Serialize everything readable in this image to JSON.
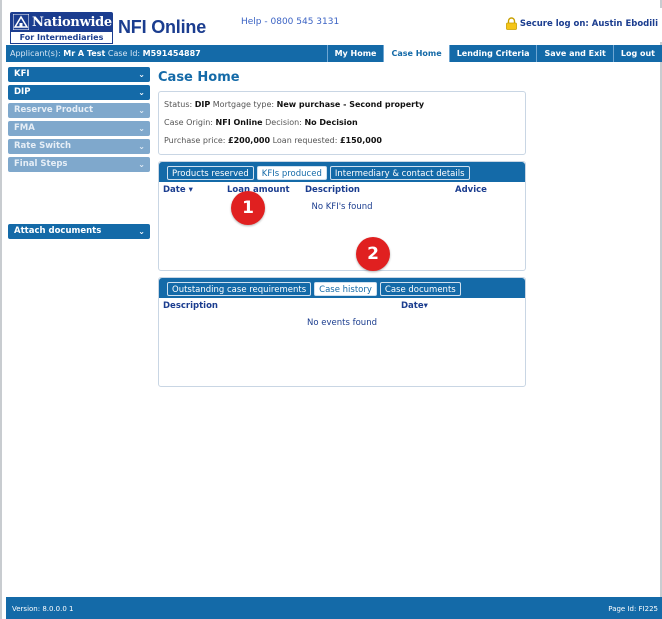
{
  "header": {
    "logo_name": "Nationwide",
    "logo_sub": "For Intermediaries",
    "app_title": "NFI Online",
    "help": "Help - 0800 545 3131",
    "secure": "Secure log on: Austin Ebodili",
    "brand_color": "#1b3d8f",
    "accent_color": "#146aa8"
  },
  "navbar": {
    "applicant_label": "Applicant(s):",
    "applicant_value": "Mr A Test",
    "case_id_label": "Case Id:",
    "case_id_value": "M591454887",
    "items": [
      "My Home",
      "Case Home",
      "Lending Criteria",
      "Save and Exit",
      "Log out"
    ],
    "active": "Case Home"
  },
  "sidebar": {
    "items": [
      {
        "label": "KFI",
        "enabled": true
      },
      {
        "label": "DIP",
        "enabled": true
      },
      {
        "label": "Reserve Product",
        "enabled": false
      },
      {
        "label": "FMA",
        "enabled": false
      },
      {
        "label": "Rate Switch",
        "enabled": false
      },
      {
        "label": "Final Steps",
        "enabled": false
      }
    ],
    "attach": "Attach documents"
  },
  "main": {
    "title": "Case Home",
    "summary": {
      "status_label": "Status:",
      "status_value": "DIP",
      "mortgage_type_label": "Mortgage type:",
      "mortgage_type_value": "New purchase - Second property",
      "case_origin_label": "Case Origin:",
      "case_origin_value": "NFI Online",
      "decision_label": "Decision:",
      "decision_value": "No Decision",
      "purchase_price_label": "Purchase price:",
      "purchase_price_value": "£200,000",
      "loan_label": "Loan requested:",
      "loan_value": "£150,000"
    },
    "panel1": {
      "tabs": [
        "Products reserved",
        "KFIs produced",
        "Intermediary & contact details"
      ],
      "active_tab": "KFIs produced",
      "columns": [
        "Date ▾",
        "Loan amount",
        "Description",
        "Advice"
      ],
      "empty": "No KFI's found"
    },
    "panel2": {
      "tabs": [
        "Outstanding case requirements",
        "Case history",
        "Case documents"
      ],
      "active_tab": "Case history",
      "columns": [
        "Description",
        "Date▾"
      ],
      "empty": "No events found"
    }
  },
  "markers": [
    "1",
    "2"
  ],
  "footer": {
    "version": "Version: 8.0.0.0 1",
    "page_id": "Page Id: FI225"
  }
}
